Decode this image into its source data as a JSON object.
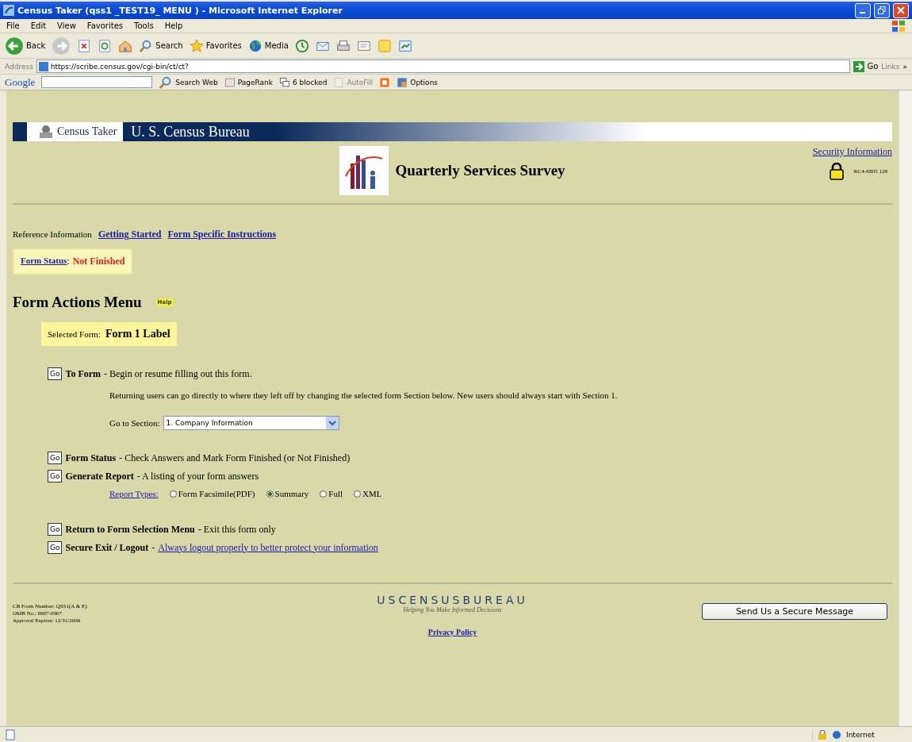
{
  "window": {
    "title": "Census Taker (qss1 _TEST19_ MENU ) - Microsoft Internet Explorer"
  },
  "menu_bar": [
    "File",
    "Edit",
    "View",
    "Favorites",
    "Tools",
    "Help"
  ],
  "toolbar": [
    {
      "kind": "back",
      "label": "Back"
    },
    {
      "kind": "forward"
    },
    {
      "kind": "stop"
    },
    {
      "kind": "refresh"
    },
    {
      "kind": "home"
    },
    {
      "kind": "search",
      "label": "Search"
    },
    {
      "kind": "favorites",
      "label": "Favorites"
    },
    {
      "kind": "media",
      "label": "Media"
    },
    {
      "kind": "history"
    },
    {
      "kind": "mail"
    },
    {
      "kind": "print"
    },
    {
      "kind": "edit"
    },
    {
      "kind": "folder"
    },
    {
      "kind": "messenger"
    }
  ],
  "address_bar": {
    "label": "Address",
    "value": "https://scribe.census.gov/cgi-bin/ct/ct?",
    "go": "Go",
    "links": "Links",
    "overflow": "»"
  },
  "google_bar": {
    "logo": "Google",
    "items": [
      {
        "kind": "search",
        "label": "Search Web",
        "disabled": false
      },
      {
        "kind": "pagerank",
        "label": "PageRank",
        "disabled": false
      },
      {
        "kind": "popup",
        "label": "6 blocked",
        "disabled": false
      },
      {
        "kind": "autofill",
        "label": "AutoFill",
        "disabled": true
      },
      {
        "kind": "blogger",
        "disabled": false
      },
      {
        "kind": "options",
        "label": "Options",
        "disabled": false
      }
    ]
  },
  "banner": {
    "app": "Census Taker",
    "agency": "U. S. Census Bureau"
  },
  "header": {
    "title": "Quarterly Services Survey",
    "security_link": "Security Information",
    "server": "RC4-MD5 128"
  },
  "reference": {
    "label": "Reference Information",
    "links": [
      "Getting Started",
      "Form Specific Instructions"
    ]
  },
  "form_status": {
    "label": "Form Status",
    "separator": ":",
    "value": "Not Finished"
  },
  "menu": {
    "title": "Form Actions Menu",
    "help": "Help",
    "selected_form_label": "Selected Form:",
    "selected_form": "Form 1 Label"
  },
  "actions": [
    {
      "kind": "to_form",
      "button": "Go",
      "title": "To Form",
      "desc": "- Begin or resume filling out this form.",
      "note": "Returning users can go directly to where they left off by changing the selected form Section below. New users should always start with Section 1.",
      "section_label": "Go to Section:",
      "section_value": "1. Company Information"
    },
    {
      "kind": "plain",
      "button": "Go",
      "title": "Form Status",
      "desc": "- Check Answers and Mark Form Finished (or Not Finished)"
    },
    {
      "kind": "report",
      "button": "Go",
      "title": "Generate Report",
      "desc": "- A listing of your form answers",
      "types_label": "Report Types:",
      "options": [
        {
          "label": "Form Facsimile(PDF)",
          "selected": false
        },
        {
          "label": "Summary",
          "selected": true
        },
        {
          "label": "Full",
          "selected": false
        },
        {
          "label": "XML",
          "selected": false
        }
      ]
    },
    {
      "kind": "plain",
      "button": "Go",
      "title": "Return to Form Selection Menu",
      "desc": "- Exit this form only"
    },
    {
      "kind": "logout",
      "button": "Go",
      "title": "Secure Exit / Logout",
      "desc": "-",
      "link": "Always logout properly to better protect your information"
    }
  ],
  "footer": {
    "form_info": [
      "CB Form Number: QSS1(A & E)",
      "OMB No.: 0607-0907",
      "Approval Expires: 12/31/2006"
    ],
    "logo": "USCENSUSBUREAU",
    "tagline": "Helping You Make Informed Decisions",
    "privacy": "Privacy Policy",
    "message_button": "Send Us a Secure Message"
  },
  "status_bar": {
    "zone": "Internet"
  }
}
